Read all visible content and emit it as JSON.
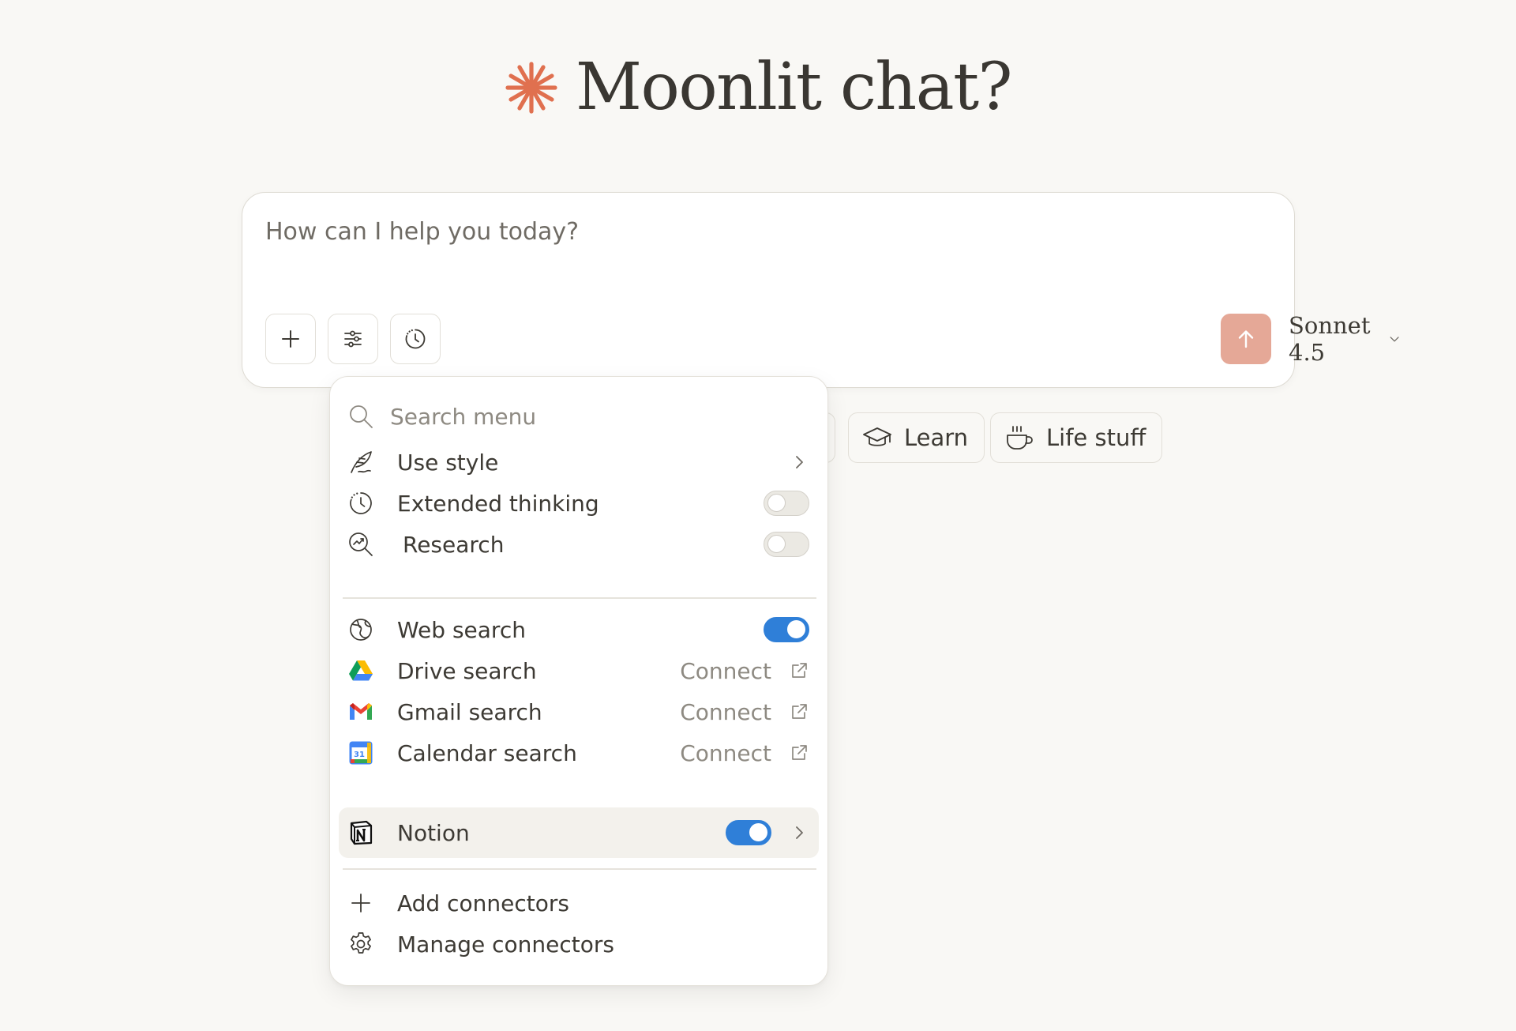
{
  "greeting": {
    "title": "Moonlit chat?",
    "logo_icon": "asterisk-burst-icon",
    "accent_color": "#e0704f"
  },
  "composer": {
    "placeholder": "How can I help you today?",
    "buttons": [
      {
        "name": "add-button",
        "icon": "plus-icon"
      },
      {
        "name": "tools-button",
        "icon": "sliders-icon"
      },
      {
        "name": "extended-thinking-button",
        "icon": "clock-icon"
      }
    ],
    "model_label": "Sonnet 4.5",
    "send_color": "#e5a897"
  },
  "chips": [
    {
      "label": "Learn",
      "icon": "graduation-cap-icon"
    },
    {
      "label": "Life stuff",
      "icon": "coffee-cup-icon"
    }
  ],
  "menu": {
    "search_placeholder": "Search menu",
    "items": [
      {
        "label": "Use style",
        "icon": "feather-pen-icon",
        "control": "submenu"
      },
      {
        "label": "Extended thinking",
        "icon": "clock-icon",
        "control": "toggle",
        "on": false
      },
      {
        "label": "Research",
        "icon": "research-magnifier-icon",
        "control": "toggle",
        "on": false
      },
      {
        "label": "Web search",
        "icon": "globe-icon",
        "control": "toggle",
        "on": true
      },
      {
        "label": "Drive search",
        "icon": "google-drive-icon",
        "control": "connect",
        "action": "Connect"
      },
      {
        "label": "Gmail search",
        "icon": "gmail-icon",
        "control": "connect",
        "action": "Connect"
      },
      {
        "label": "Calendar search",
        "icon": "google-calendar-icon",
        "control": "connect",
        "action": "Connect",
        "calendar_day": "31"
      },
      {
        "label": "Notion",
        "icon": "notion-icon",
        "control": "toggle-submenu",
        "on": true,
        "highlighted": true
      },
      {
        "label": "Add connectors",
        "icon": "plus-icon",
        "control": "none"
      },
      {
        "label": "Manage connectors",
        "icon": "gear-icon",
        "control": "none"
      }
    ],
    "toggle_on_color": "#2f7fd8"
  }
}
